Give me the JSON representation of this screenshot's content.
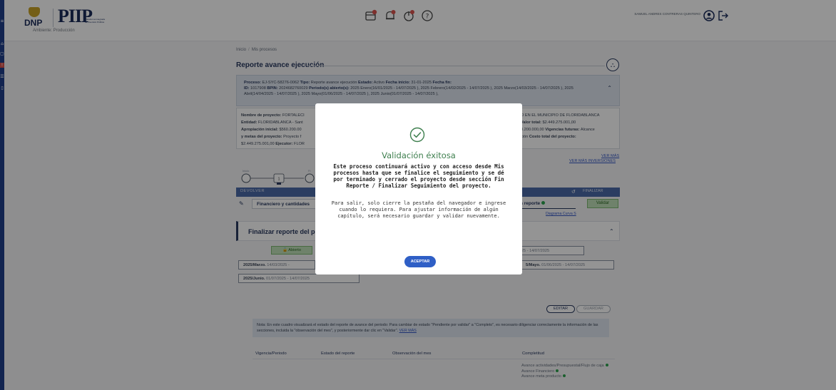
{
  "header": {
    "logo_dnp": "DNP",
    "logo_pip": "PIIP",
    "logo_sub": "Plataforma Integrada de Inversión Pública",
    "environment": "Ambiente: Producción",
    "user_name": "SAMUEL ANDRES CONTRERAS QUINTERO"
  },
  "breadcrumb": [
    "Inicio",
    "Mis procesos"
  ],
  "page_title": "Reporte avance ejecución",
  "process": {
    "line1_label_proceso": "Proceso:",
    "line1_proceso": " EJ-SYC-58276-0062 ",
    "line1_label_tipo": "Tipo:",
    "line1_tipo": " Reporte avance ejecución ",
    "line1_label_estado": "Estado:",
    "line1_estado": " Activo ",
    "line1_label_fecha": "Fecha inicio:",
    "line1_fecha": " 31-01-2025 ",
    "line1_label_fin": "Fecha fin:",
    "line2_label_id": "ID:",
    "line2_id": " 1017908 ",
    "line2_label_bpin": "BPIN:",
    "line2_bpin": " 2024682760029 ",
    "line2_label_periodos": "Periodo(s) abierto(s):",
    "line2_periodos": " 2025 Enero(16/01/2025 - 14/07/2025 ), 2025 Febrero(14/02/2025 - 14/07/2025 ), 2025 Marzo(14/03/2025 - 14/07/2025 ), 2025 Abril(14/04/2025 - 14/07/2025 ), 2025 Mayo(01/06/2025 - 14/07/2025 ), 2025 Junio(01/07/2025 - 14/07/2025 ),"
  },
  "project_info": {
    "left": [
      [
        "Nombre de proyecto:",
        " FORTALECI"
      ],
      [
        "Entidad:",
        " FLORIDABLANCA - Sant"
      ],
      [
        "Apropiación inicial:",
        " $560.200.00"
      ],
      [
        "y metas del proyecto:",
        " Proyecto f"
      ],
      [
        "",
        "$2.449.275.001,00 "
      ],
      [
        "Ejecutor:",
        " FLOR"
      ]
    ],
    "right": [
      [
        "",
        "O EN EL MUNICIPIO DE FLORIDABLANCA"
      ],
      [
        "Valor total:",
        " $2.449.275.001,00"
      ],
      [
        "",
        "0.200.000,00 "
      ],
      [
        "Vigencias futuras:",
        " Alcance"
      ],
      [
        "",
        "ción "
      ],
      [
        "Costo total del proyecto:",
        ""
      ]
    ]
  },
  "links": {
    "ver_mas": "VER MÁS",
    "ver_mas_inversiones": "VER MÁS INVERSIONES",
    "diagrama": "Diagrama Curva S"
  },
  "flow": {
    "start_label": "Inicio",
    "step": "1",
    "next_label": "Fi"
  },
  "navbar": {
    "left": "DEVOLVER",
    "right": "FINALIZAR"
  },
  "tabs": {
    "financiero": "Financiero y cantidades",
    "reporte": "n reporte",
    "validar": "Validar"
  },
  "section": {
    "title": "Finalizar reporte del periodo"
  },
  "periods": {
    "abierto": "Abierto",
    "p_top_right": "3/2025 - 14/07/2025",
    "p_marzo_label": "2025/Marzo.",
    "p_marzo_dates": " 14/03/2025 - ",
    "p_mayo_label": "5/Mayo.",
    "p_mayo_dates": " 01/06/2025 - 14/07/2025",
    "p_junio_label": "2025/Junio.",
    "p_junio_dates": " 01/07/2025 - 14/07/2025"
  },
  "actions": {
    "editar": "EDITAR",
    "guardar": "GUARDAR"
  },
  "note": {
    "text": "Nota: En este cuadro visualizará el estado del reporte de avance del periodo: Para cambiar de estado \"Pendiente por validar\" a \"Completo\", es necesario diligenciar correctamente la información de las secciones, incluida la \"observación del mes\", y posteriormente dar clic en \"Validar\". ",
    "link": "VER MÁS"
  },
  "table": {
    "headers": [
      "Vigencia/Periodo",
      "Estado del reporte",
      "Observación del mes",
      "Completitud"
    ],
    "completitud": [
      "Avance actividades/Presupuestal/Flujo de caja",
      "Avance Financiero",
      "Avance meta producto"
    ]
  },
  "modal": {
    "title": "Validación éxitosa",
    "body_bold": "Este proceso continuará activo y con acceso desde Mis procesos hasta que se finalice el seguimiento y se dé por terminado y cerrado el proyecto desde sección Fin Reporte / Finalizar Seguimiento del proyecto.",
    "body": "Para salir, solo cierre la pestaña del navegador e ingrese cuando lo requiera. Para ajustar información de algún capítulo, será necesario guardar y validar nuevamente.",
    "accept": "ACEPTAR"
  },
  "colors": {
    "primary": "#2a3a60",
    "accent_blue": "#2f5fc6",
    "success": "#3e7f4e",
    "rail": "#1f3f8a"
  }
}
